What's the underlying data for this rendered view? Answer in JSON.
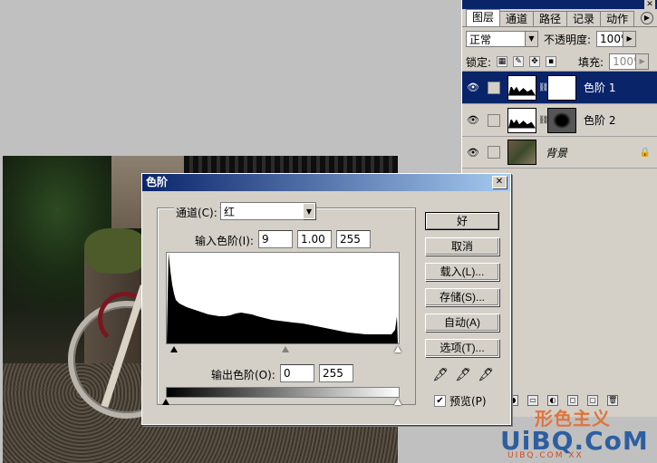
{
  "layers_panel": {
    "tabs": [
      "图层",
      "通道",
      "路径",
      "记录",
      "动作"
    ],
    "blend_mode": "正常",
    "opacity_label": "不透明度:",
    "opacity_value": "100%",
    "lock_label": "锁定:",
    "fill_label": "填充:",
    "fill_value": "100%",
    "layers": [
      {
        "name": "色阶 1"
      },
      {
        "name": "色阶 2"
      },
      {
        "name": "背景"
      }
    ]
  },
  "dialog": {
    "title": "色阶",
    "channel_label": "通道(C):",
    "channel_value": "红",
    "input_label": "输入色阶(I):",
    "input_black": "9",
    "input_gamma": "1.00",
    "input_white": "255",
    "output_label": "输出色阶(O):",
    "output_black": "0",
    "output_white": "255",
    "buttons": {
      "ok": "好",
      "cancel": "取消",
      "load": "载入(L)...",
      "save": "存储(S)...",
      "auto": "自动(A)",
      "options": "选项(T)..."
    },
    "preview_label": "预览(P)",
    "preview_checked": true
  },
  "watermark": {
    "line1": "形色主义",
    "line2": "UiBQ.CoM",
    "line3": "UIBQ.COM XX"
  },
  "colors": {
    "title_bar": "#0a246a",
    "selected_layer": "#0a246a",
    "dialog_bg": "#d4d0c8"
  }
}
